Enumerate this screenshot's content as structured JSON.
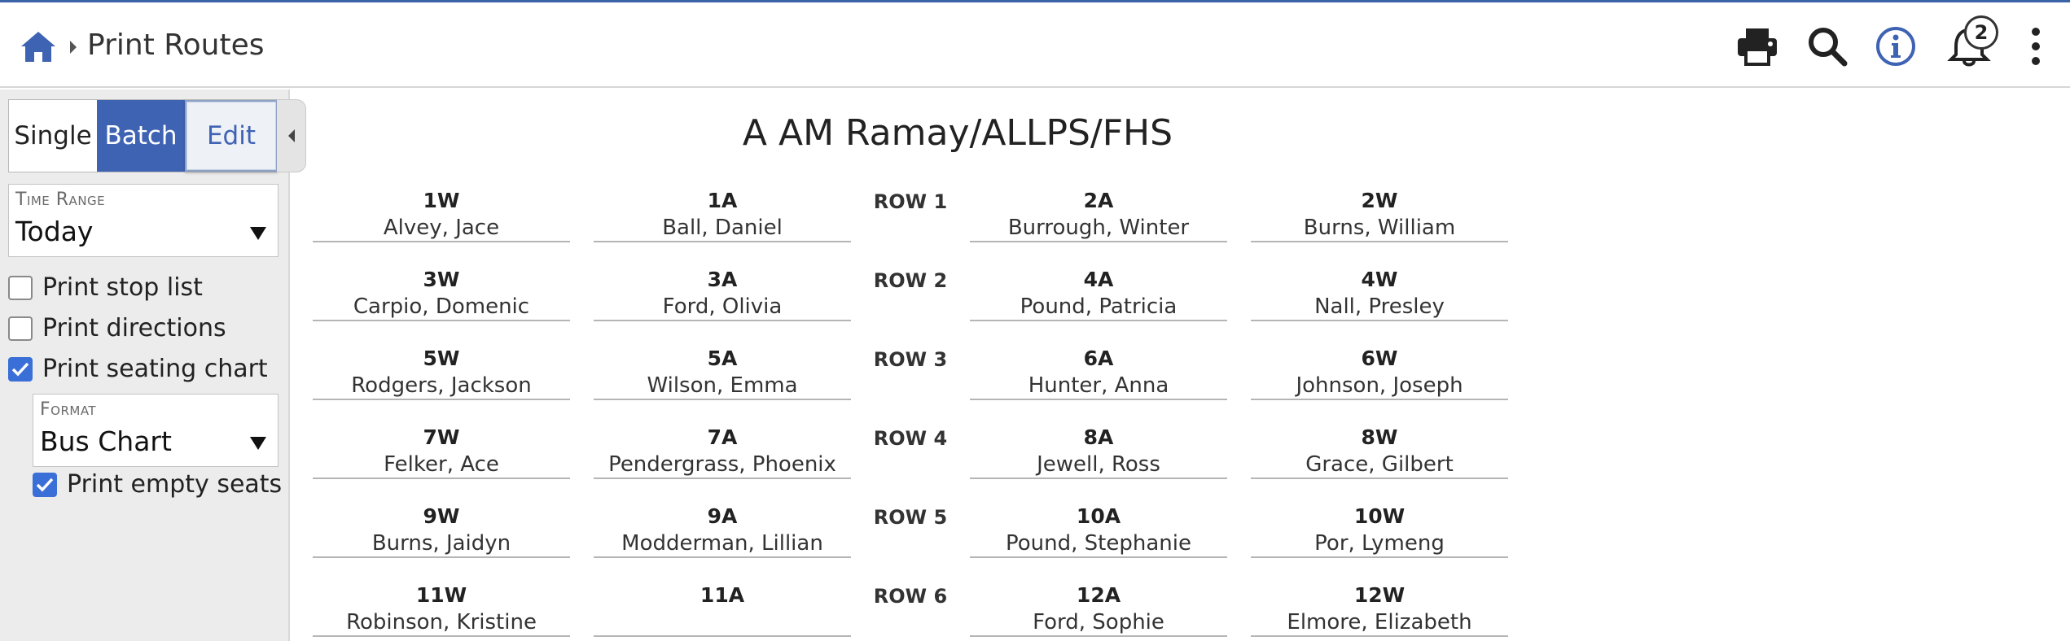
{
  "header": {
    "title": "Print Routes",
    "notification_count": "2",
    "icons": [
      "home-icon",
      "chevron-right-icon",
      "print-icon",
      "search-icon",
      "info-icon",
      "bell-icon",
      "kebab-menu-icon"
    ],
    "accent_color": "#3f63b3"
  },
  "sidebar": {
    "mode_buttons": {
      "single": "Single",
      "batch": "Batch",
      "edit": "Edit",
      "selected": "Batch"
    },
    "time_range": {
      "label": "Time Range",
      "value": "Today"
    },
    "options": {
      "print_stop_list": {
        "label": "Print stop list",
        "checked": false
      },
      "print_directions": {
        "label": "Print directions",
        "checked": false
      },
      "print_seating_chart": {
        "label": "Print seating chart",
        "checked": true
      }
    },
    "format": {
      "label": "Format",
      "value": "Bus Chart"
    },
    "print_empty_seats": {
      "label": "Print empty seats",
      "checked": true
    }
  },
  "chart": {
    "title": "A AM Ramay/ALLPS/FHS",
    "rows": [
      {
        "label": "ROW 1",
        "seats": [
          {
            "id": "1W",
            "name": "Alvey, Jace"
          },
          {
            "id": "1A",
            "name": "Ball, Daniel"
          },
          {
            "id": "2A",
            "name": "Burrough, Winter"
          },
          {
            "id": "2W",
            "name": "Burns, William"
          }
        ]
      },
      {
        "label": "ROW 2",
        "seats": [
          {
            "id": "3W",
            "name": "Carpio, Domenic"
          },
          {
            "id": "3A",
            "name": "Ford, Olivia"
          },
          {
            "id": "4A",
            "name": "Pound, Patricia"
          },
          {
            "id": "4W",
            "name": "Nall, Presley"
          }
        ]
      },
      {
        "label": "ROW 3",
        "seats": [
          {
            "id": "5W",
            "name": "Rodgers, Jackson"
          },
          {
            "id": "5A",
            "name": "Wilson, Emma"
          },
          {
            "id": "6A",
            "name": "Hunter, Anna"
          },
          {
            "id": "6W",
            "name": "Johnson, Joseph"
          }
        ]
      },
      {
        "label": "ROW 4",
        "seats": [
          {
            "id": "7W",
            "name": "Felker, Ace"
          },
          {
            "id": "7A",
            "name": "Pendergrass, Phoenix"
          },
          {
            "id": "8A",
            "name": "Jewell, Ross"
          },
          {
            "id": "8W",
            "name": "Grace, Gilbert"
          }
        ]
      },
      {
        "label": "ROW 5",
        "seats": [
          {
            "id": "9W",
            "name": "Burns, Jaidyn"
          },
          {
            "id": "9A",
            "name": "Modderman, Lillian"
          },
          {
            "id": "10A",
            "name": "Pound, Stephanie"
          },
          {
            "id": "10W",
            "name": "Por, Lymeng"
          }
        ]
      },
      {
        "label": "ROW 6",
        "seats": [
          {
            "id": "11W",
            "name": "Robinson, Kristine"
          },
          {
            "id": "11A",
            "name": ""
          },
          {
            "id": "12A",
            "name": "Ford, Sophie"
          },
          {
            "id": "12W",
            "name": "Elmore, Elizabeth"
          }
        ]
      }
    ]
  }
}
